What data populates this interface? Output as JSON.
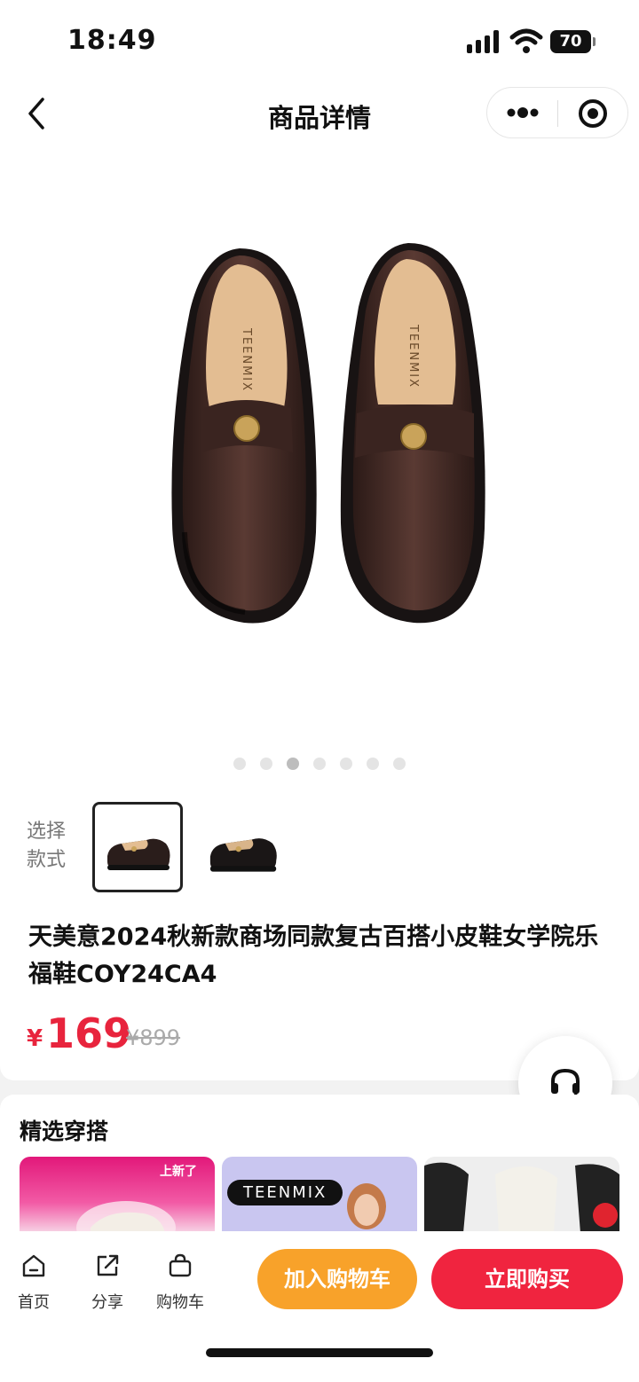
{
  "status_bar": {
    "time": "18:49",
    "battery": "70"
  },
  "nav": {
    "title": "商品详情"
  },
  "gallery": {
    "image_count": 7,
    "active_index": 2,
    "brand_text": "TEENMIX"
  },
  "product": {
    "style_label": "选择款式",
    "title": "天美意2024秋新款商场同款复古百搭小皮鞋女学院乐福鞋COY24CA4",
    "currency": "¥",
    "price": "169",
    "original_price": "¥899"
  },
  "outfit": {
    "title": "精选穿搭",
    "cards": [
      {
        "tag": "上新了"
      },
      {
        "brand": "TEENMIX"
      },
      {
        "tag": ""
      }
    ]
  },
  "bottom_bar": {
    "tabs": [
      {
        "label": "首页",
        "icon": "home-icon"
      },
      {
        "label": "分享",
        "icon": "share-icon"
      },
      {
        "label": "购物车",
        "icon": "cart-icon"
      }
    ],
    "add_to_cart": "加入购物车",
    "buy_now": "立即购买"
  },
  "colors": {
    "price_red": "#e8243d",
    "cart_orange": "#f8a22a",
    "buy_red": "#f0243f"
  }
}
